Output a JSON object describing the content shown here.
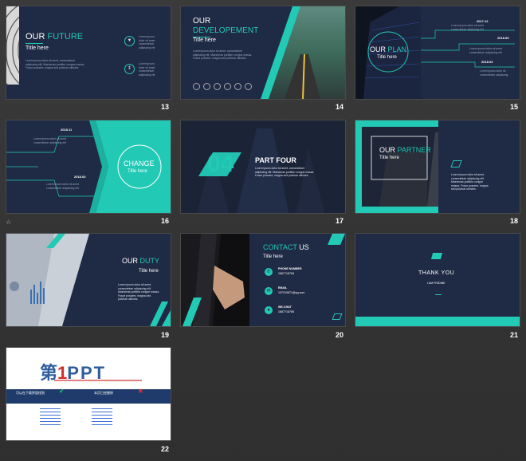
{
  "colors": {
    "navy": "#1f2a44",
    "teal": "#22c9b5",
    "page_bg": "#333333"
  },
  "slides": [
    {
      "num": "13",
      "title_w": "OUR",
      "title_t": "FUTURE",
      "sub": "Title here",
      "icons": [
        "tshirt-icon",
        "thermometer-icon"
      ]
    },
    {
      "num": "14",
      "title_w": "OUR",
      "title_t": "DEVELOPEMENT",
      "sub": "Title here"
    },
    {
      "num": "15",
      "title_w": "OUR",
      "title_t": "PLAN",
      "sub": "Title here",
      "dates": [
        "2017.12",
        "2018.09",
        "2018.03"
      ]
    },
    {
      "num": "16",
      "big": "CHANGE",
      "sub": "Title here",
      "dates": [
        "2018.11",
        "2018.03"
      ]
    },
    {
      "num": "17",
      "big": "04",
      "title_w": "PART",
      "title_t": "FOUR"
    },
    {
      "num": "18",
      "title_w": "OUR",
      "title_t": "PARTNER",
      "sub": "Title here"
    },
    {
      "num": "19",
      "title_w": "OUR",
      "title_t": "DUTY",
      "sub": "Title here"
    },
    {
      "num": "20",
      "title_t": "CONTACT",
      "title_w": "US",
      "sub": "Title here",
      "labels": [
        "PHONE NUMBER",
        "EMAIL",
        "WE-CHAT"
      ],
      "values": [
        "1687718765",
        "107219871@qq.com",
        "1687718765"
      ]
    },
    {
      "num": "21",
      "big": "THANK YOU",
      "sub": "I AM FRIDINE"
    },
    {
      "num": "22",
      "logo_a": "第",
      "logo_b": "1",
      "logo_c": "PPT",
      "bar_left": "可以在下载界面找到",
      "bar_right": "本页已经删除"
    }
  ]
}
